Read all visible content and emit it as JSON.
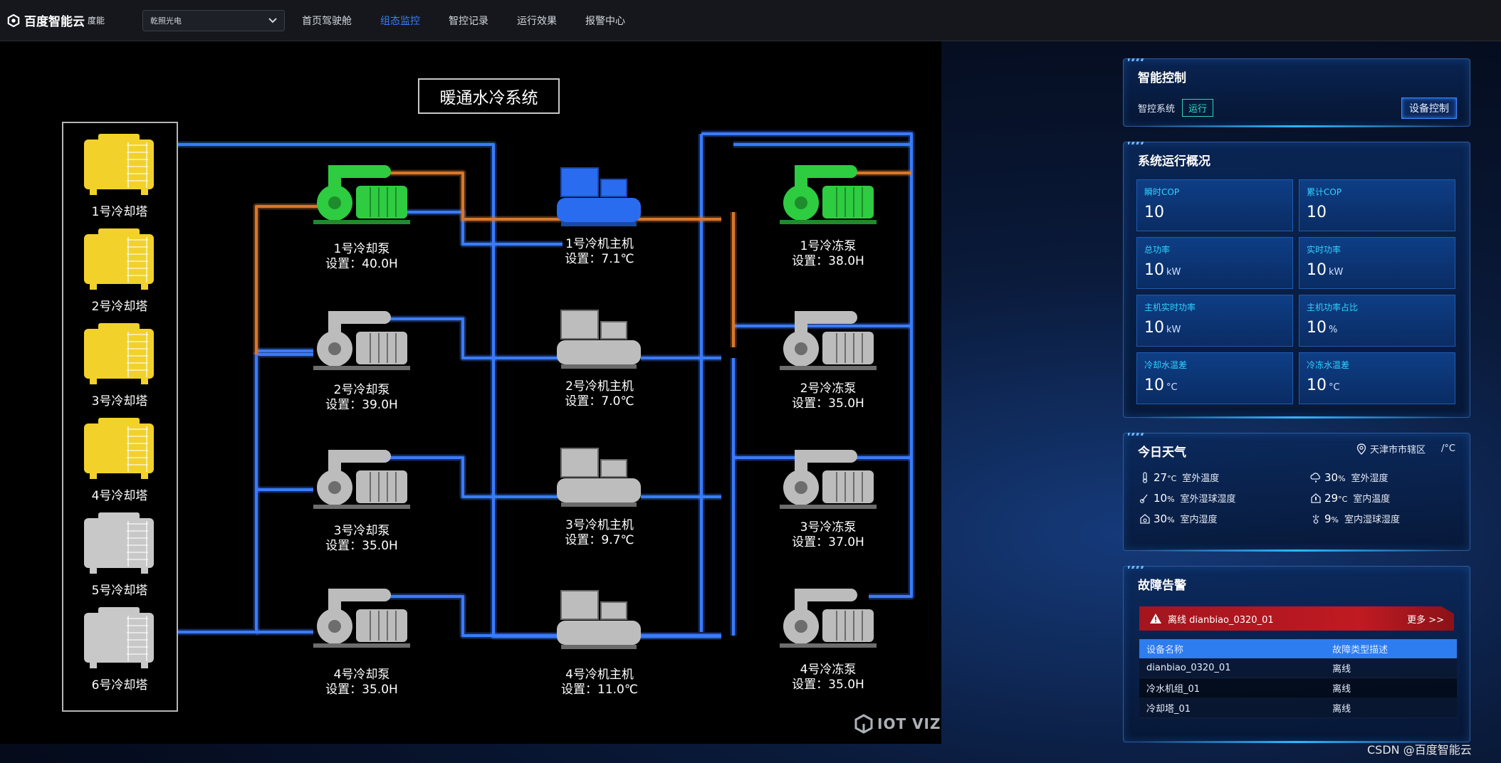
{
  "brand": {
    "name": "百度智能云",
    "sub": "度能"
  },
  "site_select": {
    "value": "乾照光电"
  },
  "nav": [
    "首页驾驶舱",
    "组态监控",
    "智控记录",
    "运行效果",
    "报警中心"
  ],
  "nav_active_index": 1,
  "scada": {
    "title": "暖通水冷系统",
    "towers": [
      "1号冷却塔",
      "2号冷却塔",
      "3号冷却塔",
      "4号冷却塔",
      "5号冷却塔",
      "6号冷却塔"
    ],
    "tower_states": [
      "on",
      "on",
      "on",
      "on",
      "off",
      "off"
    ],
    "cooling_pumps": [
      {
        "name": "1号冷却泵",
        "set": "设置：40.0H"
      },
      {
        "name": "2号冷却泵",
        "set": "设置：39.0H"
      },
      {
        "name": "3号冷却泵",
        "set": "设置：35.0H"
      },
      {
        "name": "4号冷却泵",
        "set": "设置：35.0H"
      }
    ],
    "chillers": [
      {
        "name": "1号冷机主机",
        "set": "设置：7.1℃"
      },
      {
        "name": "2号冷机主机",
        "set": "设置：7.0℃"
      },
      {
        "name": "3号冷机主机",
        "set": "设置：9.7℃"
      },
      {
        "name": "4号冷机主机",
        "set": "设置：11.0℃"
      }
    ],
    "chilled_pumps": [
      {
        "name": "1号冷冻泵",
        "set": "设置：38.0H"
      },
      {
        "name": "2号冷冻泵",
        "set": "设置：35.0H"
      },
      {
        "name": "3号冷冻泵",
        "set": "设置：37.0H"
      },
      {
        "name": "4号冷冻泵",
        "set": "设置：35.0H"
      }
    ],
    "logo_text": "IOT VIZ",
    "colors": {
      "pipe_blue": "#3a7bff",
      "pipe_orange": "#d9772a",
      "running": "#2ecc40",
      "running_chiller": "#2a6cf0",
      "tower_on": "#f2d12a",
      "tower_off": "#c8c8c8"
    }
  },
  "control": {
    "title": "智能控制",
    "system_label": "智控系统",
    "status": "运行",
    "device_button": "设备控制"
  },
  "overview": {
    "title": "系统运行概况",
    "kpis": [
      {
        "label": "瞬时COP",
        "value": "10",
        "unit": ""
      },
      {
        "label": "累计COP",
        "value": "10",
        "unit": ""
      },
      {
        "label": "总功率",
        "value": "10",
        "unit": "kW"
      },
      {
        "label": "实时功率",
        "value": "10",
        "unit": "kW"
      },
      {
        "label": "主机实时功率",
        "value": "10",
        "unit": "kW"
      },
      {
        "label": "主机功率占比",
        "value": "10",
        "unit": "%"
      },
      {
        "label": "冷却水温差",
        "value": "10",
        "unit": "°C"
      },
      {
        "label": "冷冻水温差",
        "value": "10",
        "unit": "°C"
      }
    ]
  },
  "weather": {
    "title": "今日天气",
    "location": "天津市市辖区",
    "unit_toggle": "/°C",
    "items": [
      {
        "value": "27",
        "unit": "°C",
        "label": "室外温度",
        "icon": "thermometer-icon"
      },
      {
        "value": "30",
        "unit": "%",
        "label": "室外湿度",
        "icon": "cloud-drop-icon"
      },
      {
        "value": "10",
        "unit": "%",
        "label": "室外湿球湿度",
        "icon": "wet-bulb-icon"
      },
      {
        "value": "29",
        "unit": "°C",
        "label": "室内温度",
        "icon": "indoor-temp-icon"
      },
      {
        "value": "30",
        "unit": "%",
        "label": "室内湿度",
        "icon": "indoor-humidity-icon"
      },
      {
        "value": "9",
        "unit": "%",
        "label": "室内湿球湿度",
        "icon": "indoor-wet-bulb-icon"
      }
    ]
  },
  "alarm": {
    "title": "故障告警",
    "banner": "离线 dianbiao_0320_01",
    "more": "更多 >>",
    "columns": [
      "设备名称",
      "故障类型描述"
    ],
    "rows": [
      [
        "dianbiao_0320_01",
        "离线"
      ],
      [
        "冷水机组_01",
        "离线"
      ],
      [
        "冷却塔_01",
        "离线"
      ]
    ]
  },
  "footer": {
    "credit": "CSDN @百度智能云"
  }
}
